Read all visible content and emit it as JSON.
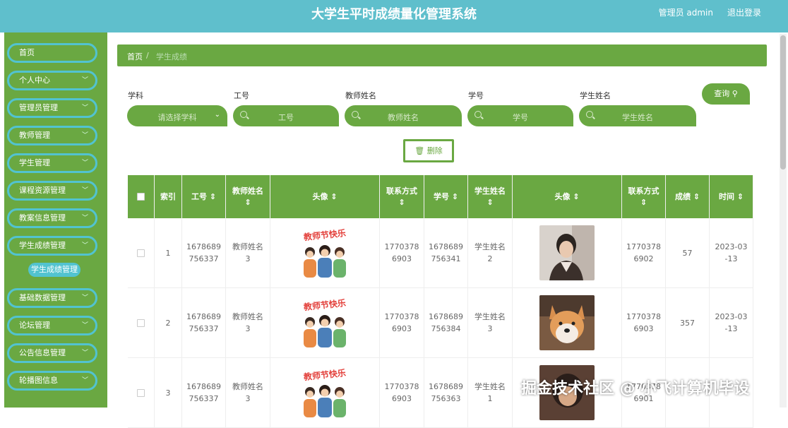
{
  "header": {
    "title": "大学生平时成绩量化管理系统",
    "admin": "管理员 admin",
    "logout": "退出登录"
  },
  "sidebar": {
    "items": [
      {
        "label": "首页",
        "chev": ""
      },
      {
        "label": "个人中心",
        "chev": "﹀"
      },
      {
        "label": "管理员管理",
        "chev": "﹀"
      },
      {
        "label": "教师管理",
        "chev": "﹀"
      },
      {
        "label": "学生管理",
        "chev": "﹀"
      },
      {
        "label": "课程资源管理",
        "chev": "﹀"
      },
      {
        "label": "教案信息管理",
        "chev": "﹀"
      },
      {
        "label": "学生成绩管理",
        "chev": "﹀"
      },
      {
        "label": "基础数据管理",
        "chev": "﹀"
      },
      {
        "label": "论坛管理",
        "chev": "﹀"
      },
      {
        "label": "公告信息管理",
        "chev": "﹀"
      },
      {
        "label": "轮播图信息",
        "chev": "﹀"
      }
    ],
    "sub_active": "学生成绩管理"
  },
  "breadcrumb": {
    "home": "首页",
    "sep": "/",
    "current": "学生成绩"
  },
  "search": {
    "labels": {
      "subject": "学科",
      "staff_no": "工号",
      "teacher_name": "教师姓名",
      "student_no": "学号",
      "student_name": "学生姓名"
    },
    "placeholders": {
      "subject": "请选择学科",
      "staff_no": "工号",
      "teacher_name": "教师姓名",
      "student_no": "学号",
      "student_name": "学生姓名"
    },
    "query_button": "查询 ⚲"
  },
  "actions": {
    "delete_button": "🗑 删除"
  },
  "table": {
    "headers": {
      "index": "索引",
      "staff_no": "工号 ⇕",
      "teacher_name": "教师姓名",
      "teacher_name_sort": "⇕",
      "teacher_avatar": "头像 ⇕",
      "teacher_contact": "联系方式",
      "teacher_contact_sort": "⇕",
      "student_no": "学号 ⇕",
      "student_name": "学生姓名",
      "student_name_sort": "⇕",
      "student_avatar": "头像 ⇕",
      "student_contact": "联系方式",
      "student_contact_sort": "⇕",
      "score": "成绩 ⇕",
      "time": "时间 ⇕"
    },
    "rows": [
      {
        "index": "1",
        "staff_no": "1678689\n756337",
        "teacher_name": "教师姓名\n3",
        "poster_text": "教师节快乐",
        "teacher_contact": "1770378\n6903",
        "student_no": "1678689\n756341",
        "student_name": "学生姓名\n2",
        "student_contact": "1770378\n6902",
        "score": "57",
        "time": "2023-03\n-13"
      },
      {
        "index": "2",
        "staff_no": "1678689\n756337",
        "teacher_name": "教师姓名\n3",
        "poster_text": "教师节快乐",
        "teacher_contact": "1770378\n6903",
        "student_no": "1678689\n756384",
        "student_name": "学生姓名\n3",
        "student_contact": "1770378\n6903",
        "score": "357",
        "time": "2023-03\n-13"
      },
      {
        "index": "3",
        "staff_no": "1678689\n756337",
        "teacher_name": "教师姓名\n3",
        "poster_text": "教师节快乐",
        "teacher_contact": "1770378\n6903",
        "student_no": "1678689\n756363",
        "student_name": "学生姓名\n1",
        "student_contact": "1770378\n6901",
        "score": "",
        "time": ""
      }
    ]
  },
  "watermark": "掘金技术社区 @ 小飞计算机毕设",
  "colors": {
    "header": "#5fbfcc",
    "primary_green": "#6aa842",
    "accent_cyan": "#52c3d0"
  }
}
